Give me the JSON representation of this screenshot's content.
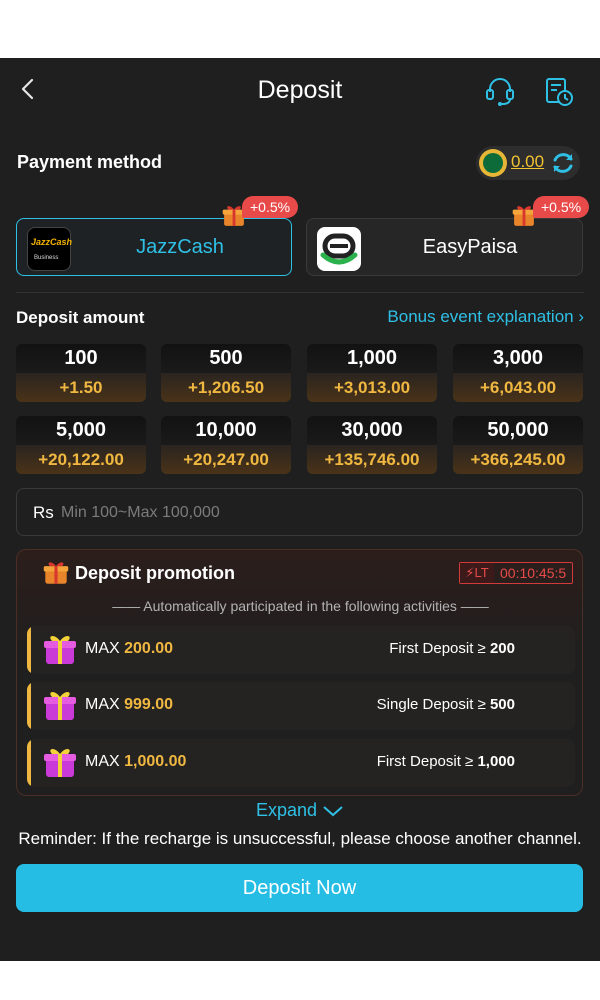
{
  "header": {
    "title": "Deposit",
    "icons": [
      "back-arrow-icon",
      "customer-service-icon",
      "deposit-record-icon"
    ]
  },
  "payment_method": {
    "label": "Payment method",
    "balance": "0.00",
    "methods": [
      {
        "name": "JazzCash",
        "logo_text": "JazzCash",
        "logo_sub": "Business",
        "bonus": "+0.5%",
        "selected": true
      },
      {
        "name": "EasyPaisa",
        "bonus": "+0.5%",
        "selected": false
      }
    ]
  },
  "deposit_amount": {
    "label": "Deposit amount",
    "bonus_link": "Bonus event explanation ›",
    "options": [
      {
        "amount": "100",
        "bonus": "+1.50"
      },
      {
        "amount": "500",
        "bonus": "+1,206.50"
      },
      {
        "amount": "1,000",
        "bonus": "+3,013.00"
      },
      {
        "amount": "3,000",
        "bonus": "+6,043.00"
      },
      {
        "amount": "5,000",
        "bonus": "+20,122.00"
      },
      {
        "amount": "10,000",
        "bonus": "+20,247.00"
      },
      {
        "amount": "30,000",
        "bonus": "+135,746.00"
      },
      {
        "amount": "50,000",
        "bonus": "+366,245.00"
      }
    ],
    "input": {
      "currency": "Rs",
      "placeholder": "Min 100~Max 100,000",
      "value": ""
    }
  },
  "promotion": {
    "title": "Deposit promotion",
    "timer_label": "LT",
    "timer": "00:10:45:5",
    "subtitle": "—— Automatically participated in the following activities ——",
    "items": [
      {
        "max_label": "MAX",
        "max_value": "200.00",
        "condition": "First Deposit ≥",
        "threshold": "200"
      },
      {
        "max_label": "MAX",
        "max_value": "999.00",
        "condition": "Single Deposit ≥",
        "threshold": "500"
      },
      {
        "max_label": "MAX",
        "max_value": "1,000.00",
        "condition": "First Deposit ≥",
        "threshold": "1,000"
      }
    ]
  },
  "expand_label": "Expand",
  "reminder": "Reminder: If the recharge is unsuccessful, please choose another channel.",
  "deposit_button": "Deposit Now",
  "colors": {
    "accent": "#25bde4",
    "gold": "#f0b840",
    "alert": "#e84a4a",
    "background": "#1f1f1f"
  }
}
